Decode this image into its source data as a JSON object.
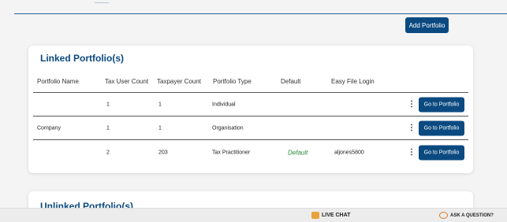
{
  "toolbar": {
    "add_portfolio_label": "Add Portfolio"
  },
  "linked": {
    "title": "Linked Portfolio(s)",
    "columns": [
      "Portfolio Name",
      "Tax User Count",
      "Taxpayer Count",
      "Portfolio Type",
      "Default",
      "Easy File Login"
    ],
    "rows": [
      {
        "name": "",
        "tax_user_count": "1",
        "taxpayer_count": "1",
        "type": "Individual",
        "default": "",
        "easy_file_login": "",
        "action_label": "Go to Portfolio"
      },
      {
        "name": "Company",
        "tax_user_count": "1",
        "taxpayer_count": "1",
        "type": "Organisation",
        "default": "",
        "easy_file_login": "",
        "action_label": "Go to Portfolio"
      },
      {
        "name": "",
        "tax_user_count": "2",
        "taxpayer_count": "203",
        "type": "Tax Practitioner",
        "default": "Default",
        "easy_file_login": "aljones5800",
        "action_label": "Go to Portfolio"
      }
    ],
    "menu_glyph": "⋮"
  },
  "unlinked": {
    "title": "Unlinked Portfolio(s)"
  },
  "chat": {
    "live_chat_label": "LIVE CHAT",
    "ask_question_label": "ASK A QUESTION?"
  },
  "colors": {
    "primary": "#0b4a80",
    "default_tag": "#2c8a3a",
    "background": "#f4f4f5"
  }
}
